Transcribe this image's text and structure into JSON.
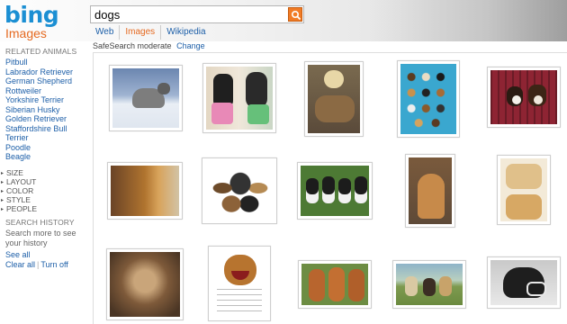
{
  "header": {
    "logo": "bing",
    "section": "Images",
    "search_value": "dogs"
  },
  "tabs": [
    {
      "label": "Web"
    },
    {
      "label": "Images",
      "active": true
    },
    {
      "label": "Wikipedia"
    }
  ],
  "safesearch": {
    "text": "SafeSearch moderate",
    "change": "Change"
  },
  "sidebar": {
    "related_title": "RELATED ANIMALS",
    "related": [
      "Pitbull",
      "Labrador Retriever",
      "German Shepherd",
      "Rottweiler",
      "Yorkshire Terrier",
      "Siberian Husky",
      "Golden Retriever",
      "Staffordshire Bull Terrier",
      "Poodle",
      "Beagle"
    ],
    "filters": [
      "SIZE",
      "LAYOUT",
      "COLOR",
      "STYLE",
      "PEOPLE"
    ],
    "history_title": "SEARCH HISTORY",
    "history_note": "Search more to see your history",
    "see_all": "See all",
    "clear_all": "Clear all",
    "turn_off": "Turn off"
  },
  "images": [
    {
      "name": "husky-puppy-snow"
    },
    {
      "name": "two-dogs-dressed"
    },
    {
      "name": "woman-holding-puppies"
    },
    {
      "name": "dog-breeds-chart"
    },
    {
      "name": "puppies-in-crate"
    },
    {
      "name": "yorkie-closeup"
    },
    {
      "name": "group-of-dogs"
    },
    {
      "name": "border-collies-row"
    },
    {
      "name": "sitting-golden-dog"
    },
    {
      "name": "before-after-dogs"
    },
    {
      "name": "shaggy-dog-face"
    },
    {
      "name": "cartoon-dog-crazy"
    },
    {
      "name": "three-vizslas"
    },
    {
      "name": "dogs-in-field"
    },
    {
      "name": "dog-with-muzzle"
    }
  ]
}
